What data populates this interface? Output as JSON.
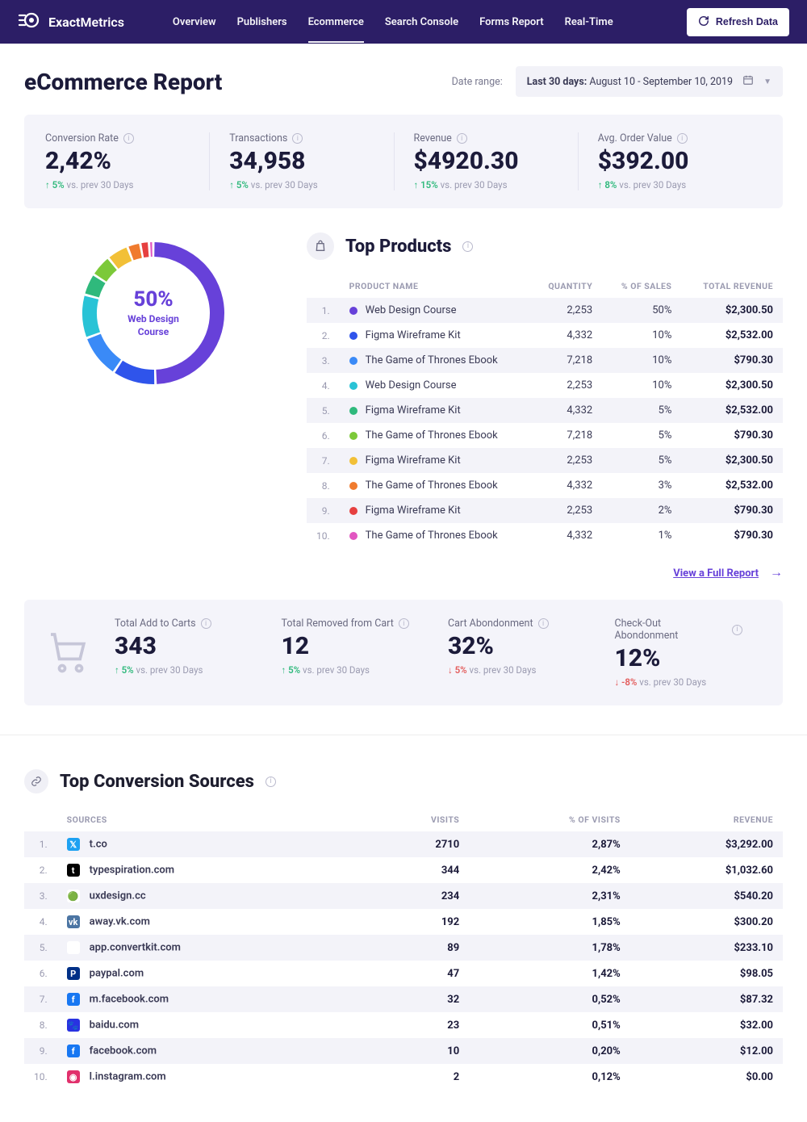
{
  "brand": {
    "name_bold": "Exact",
    "name_rest": "Metrics"
  },
  "nav": {
    "items": [
      "Overview",
      "Publishers",
      "Ecommerce",
      "Search Console",
      "Forms Report",
      "Real-Time"
    ],
    "active": "Ecommerce"
  },
  "refresh_label": "Refresh Data",
  "page_title": "eCommerce Report",
  "date_range": {
    "label": "Date range:",
    "prefix": "Last 30 days:",
    "value": "August 10 - September 10, 2019"
  },
  "kpis": [
    {
      "label": "Conversion Rate",
      "value": "2,42%",
      "delta": "5%",
      "dir": "up",
      "suffix": "vs. prev 30 Days"
    },
    {
      "label": "Transactions",
      "value": "34,958",
      "delta": "5%",
      "dir": "up",
      "suffix": "vs. prev 30 Days"
    },
    {
      "label": "Revenue",
      "value": "$4920.30",
      "delta": "15%",
      "dir": "up",
      "suffix": "vs. prev 30 Days"
    },
    {
      "label": "Avg. Order Value",
      "value": "$392.00",
      "delta": "8%",
      "dir": "up",
      "suffix": "vs. prev 30 Days"
    }
  ],
  "top_products": {
    "title": "Top Products",
    "columns": [
      "PRODUCT NAME",
      "QUANTITY",
      "% OF SALES",
      "TOTAL REVENUE"
    ],
    "donut_center": {
      "pct": "50%",
      "name": "Web Design Course"
    },
    "rows": [
      {
        "rank": "1.",
        "color": "#6741d9",
        "name": "Web Design Course",
        "qty": "2,253",
        "pct": "50%",
        "rev": "$2,300.50"
      },
      {
        "rank": "2.",
        "color": "#2f54eb",
        "name": "Figma Wireframe Kit",
        "qty": "4,332",
        "pct": "10%",
        "rev": "$2,532.00"
      },
      {
        "rank": "3.",
        "color": "#3a8af7",
        "name": "The Game of Thrones Ebook",
        "qty": "7,218",
        "pct": "10%",
        "rev": "$790.30"
      },
      {
        "rank": "4.",
        "color": "#29c3d6",
        "name": "Web Design Course",
        "qty": "2,253",
        "pct": "10%",
        "rev": "$2,300.50"
      },
      {
        "rank": "5.",
        "color": "#2fb97c",
        "name": "Figma Wireframe Kit",
        "qty": "4,332",
        "pct": "5%",
        "rev": "$2,532.00"
      },
      {
        "rank": "6.",
        "color": "#7cc939",
        "name": "The Game of Thrones Ebook",
        "qty": "7,218",
        "pct": "5%",
        "rev": "$790.30"
      },
      {
        "rank": "7.",
        "color": "#f2c037",
        "name": "Figma Wireframe Kit",
        "qty": "2,253",
        "pct": "5%",
        "rev": "$2,300.50"
      },
      {
        "rank": "8.",
        "color": "#f07b2e",
        "name": "The Game of Thrones Ebook",
        "qty": "4,332",
        "pct": "3%",
        "rev": "$2,532.00"
      },
      {
        "rank": "9.",
        "color": "#e64040",
        "name": "Figma Wireframe Kit",
        "qty": "2,253",
        "pct": "2%",
        "rev": "$790.30"
      },
      {
        "rank": "10.",
        "color": "#e256c1",
        "name": "The Game of Thrones Ebook",
        "qty": "4,332",
        "pct": "1%",
        "rev": "$790.30"
      }
    ],
    "full_report": "View a Full Report"
  },
  "cart_kpis": [
    {
      "label": "Total Add to Carts",
      "value": "343",
      "delta": "5%",
      "dir": "up",
      "suffix": "vs. prev 30 Days"
    },
    {
      "label": "Total Removed from Cart",
      "value": "12",
      "delta": "5%",
      "dir": "up",
      "suffix": "vs. prev 30 Days"
    },
    {
      "label": "Cart Abondonment",
      "value": "32%",
      "delta": "5%",
      "dir": "down",
      "suffix": "vs. prev 30 Days"
    },
    {
      "label": "Check-Out Abondonment",
      "value": "12%",
      "delta": "-8%",
      "dir": "down",
      "suffix": "vs. prev 30 Days"
    }
  ],
  "sources": {
    "title": "Top Conversion Sources",
    "columns": [
      "SOURCES",
      "VISITS",
      "% OF VISITS",
      "REVENUE"
    ],
    "rows": [
      {
        "rank": "1.",
        "icon_bg": "#1DA1F2",
        "icon_text": "𝕏",
        "name": "t.co",
        "visits": "2710",
        "pct": "2,87%",
        "rev": "$3,292.00"
      },
      {
        "rank": "2.",
        "icon_bg": "#000",
        "icon_text": "t",
        "name": "typespiration.com",
        "visits": "344",
        "pct": "2,42%",
        "rev": "$1,032.60"
      },
      {
        "rank": "3.",
        "icon_bg": "#fff",
        "icon_text": "🟢",
        "name": "uxdesign.cc",
        "visits": "234",
        "pct": "2,31%",
        "rev": "$540.20"
      },
      {
        "rank": "4.",
        "icon_bg": "#4c75a3",
        "icon_text": "vk",
        "name": "away.vk.com",
        "visits": "192",
        "pct": "1,85%",
        "rev": "$300.20"
      },
      {
        "rank": "5.",
        "icon_bg": "#fff",
        "icon_text": "◯",
        "name": "app.convertkit.com",
        "visits": "89",
        "pct": "1,78%",
        "rev": "$233.10"
      },
      {
        "rank": "6.",
        "icon_bg": "#003087",
        "icon_text": "P",
        "name": "paypal.com",
        "visits": "47",
        "pct": "1,42%",
        "rev": "$98.05"
      },
      {
        "rank": "7.",
        "icon_bg": "#1877F2",
        "icon_text": "f",
        "name": "m.facebook.com",
        "visits": "32",
        "pct": "0,52%",
        "rev": "$87.32"
      },
      {
        "rank": "8.",
        "icon_bg": "#2932e1",
        "icon_text": "🐾",
        "name": "baidu.com",
        "visits": "23",
        "pct": "0,51%",
        "rev": "$32.00"
      },
      {
        "rank": "9.",
        "icon_bg": "#1877F2",
        "icon_text": "f",
        "name": "facebook.com",
        "visits": "10",
        "pct": "0,20%",
        "rev": "$12.00"
      },
      {
        "rank": "10.",
        "icon_bg": "#e1306c",
        "icon_text": "◉",
        "name": "l.instagram.com",
        "visits": "2",
        "pct": "0,12%",
        "rev": "$0.00"
      }
    ]
  },
  "chart_data": {
    "type": "pie",
    "title": "Top Products — % of Sales",
    "series": [
      {
        "name": "Web Design Course",
        "value": 50,
        "color": "#6741d9"
      },
      {
        "name": "Figma Wireframe Kit",
        "value": 10,
        "color": "#2f54eb"
      },
      {
        "name": "The Game of Thrones Ebook",
        "value": 10,
        "color": "#3a8af7"
      },
      {
        "name": "Web Design Course",
        "value": 10,
        "color": "#29c3d6"
      },
      {
        "name": "Figma Wireframe Kit",
        "value": 5,
        "color": "#2fb97c"
      },
      {
        "name": "The Game of Thrones Ebook",
        "value": 5,
        "color": "#7cc939"
      },
      {
        "name": "Figma Wireframe Kit",
        "value": 5,
        "color": "#f2c037"
      },
      {
        "name": "The Game of Thrones Ebook",
        "value": 3,
        "color": "#f07b2e"
      },
      {
        "name": "Figma Wireframe Kit",
        "value": 2,
        "color": "#e64040"
      },
      {
        "name": "The Game of Thrones Ebook",
        "value": 1,
        "color": "#e256c1"
      }
    ]
  }
}
